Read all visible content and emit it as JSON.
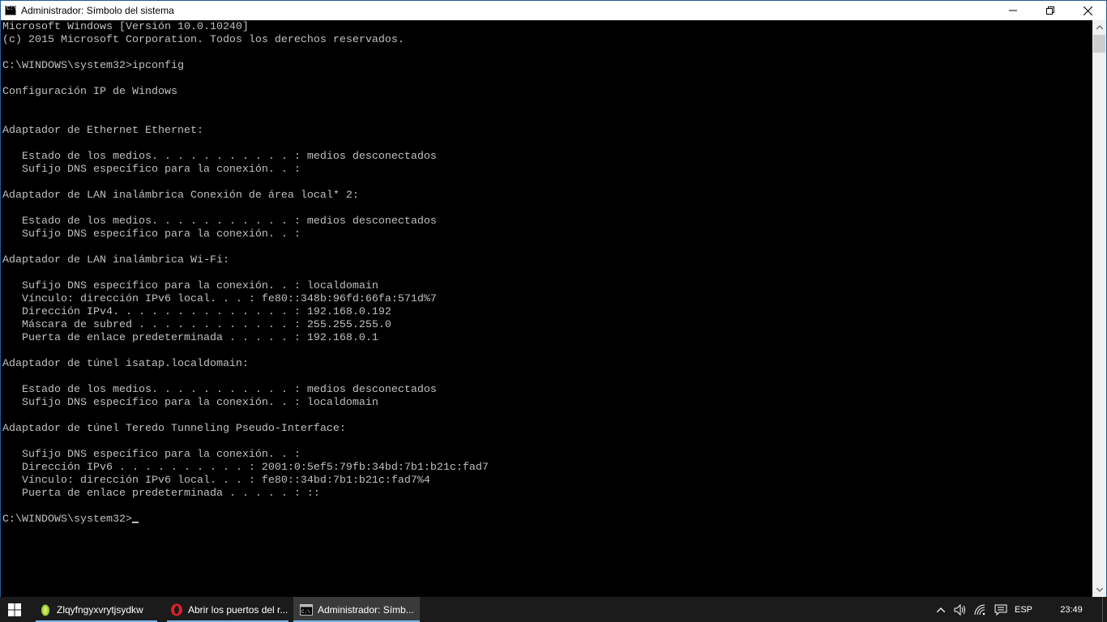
{
  "window": {
    "title": "Administrador: Símbolo del sistema",
    "icon": "cmd-icon",
    "buttons": {
      "minimize": "minimize-icon",
      "maximize": "maximize-icon",
      "close": "close-icon"
    }
  },
  "console": {
    "lines": [
      "Microsoft Windows [Versión 10.0.10240]",
      "(c) 2015 Microsoft Corporation. Todos los derechos reservados.",
      "",
      "C:\\WINDOWS\\system32>ipconfig",
      "",
      "Configuración IP de Windows",
      "",
      "",
      "Adaptador de Ethernet Ethernet:",
      "",
      "   Estado de los medios. . . . . . . . . . . : medios desconectados",
      "   Sufijo DNS específico para la conexión. . :",
      "",
      "Adaptador de LAN inalámbrica Conexión de área local* 2:",
      "",
      "   Estado de los medios. . . . . . . . . . . : medios desconectados",
      "   Sufijo DNS específico para la conexión. . :",
      "",
      "Adaptador de LAN inalámbrica Wi-Fi:",
      "",
      "   Sufijo DNS específico para la conexión. . : localdomain",
      "   Vínculo: dirección IPv6 local. . . : fe80::348b:96fd:66fa:571d%7",
      "   Dirección IPv4. . . . . . . . . . . . . . : 192.168.0.192",
      "   Máscara de subred . . . . . . . . . . . . : 255.255.255.0",
      "   Puerta de enlace predeterminada . . . . . : 192.168.0.1",
      "",
      "Adaptador de túnel isatap.localdomain:",
      "",
      "   Estado de los medios. . . . . . . . . . . : medios desconectados",
      "   Sufijo DNS específico para la conexión. . : localdomain",
      "",
      "Adaptador de túnel Teredo Tunneling Pseudo-Interface:",
      "",
      "   Sufijo DNS específico para la conexión. . :",
      "   Dirección IPv6 . . . . . . . . . . : 2001:0:5ef5:79fb:34bd:7b1:b21c:fad7",
      "   Vínculo: dirección IPv6 local. . . : fe80::34bd:7b1:b21c:fad7%4",
      "   Puerta de enlace predeterminada . . . . . : ::",
      ""
    ],
    "prompt": "C:\\WINDOWS\\system32>"
  },
  "taskbar": {
    "start_icon": "windows-logo-icon",
    "tasks": [
      {
        "label": "Zlqyfngyxvrytjsydkw",
        "icon": "leaf-app-icon",
        "active": false
      },
      {
        "label": "Abrir los puertos del r...",
        "icon": "opera-icon",
        "active": false
      },
      {
        "label": "Administrador: Símb...",
        "icon": "cmd-icon",
        "active": true
      }
    ],
    "tray": {
      "language": "ESP",
      "time": "23:49"
    }
  },
  "colors": {
    "console_bg": "#000000",
    "console_fg": "#c0c0c0",
    "taskbar_bg": "#1b1b1b",
    "accent": "#7ab3e8"
  }
}
